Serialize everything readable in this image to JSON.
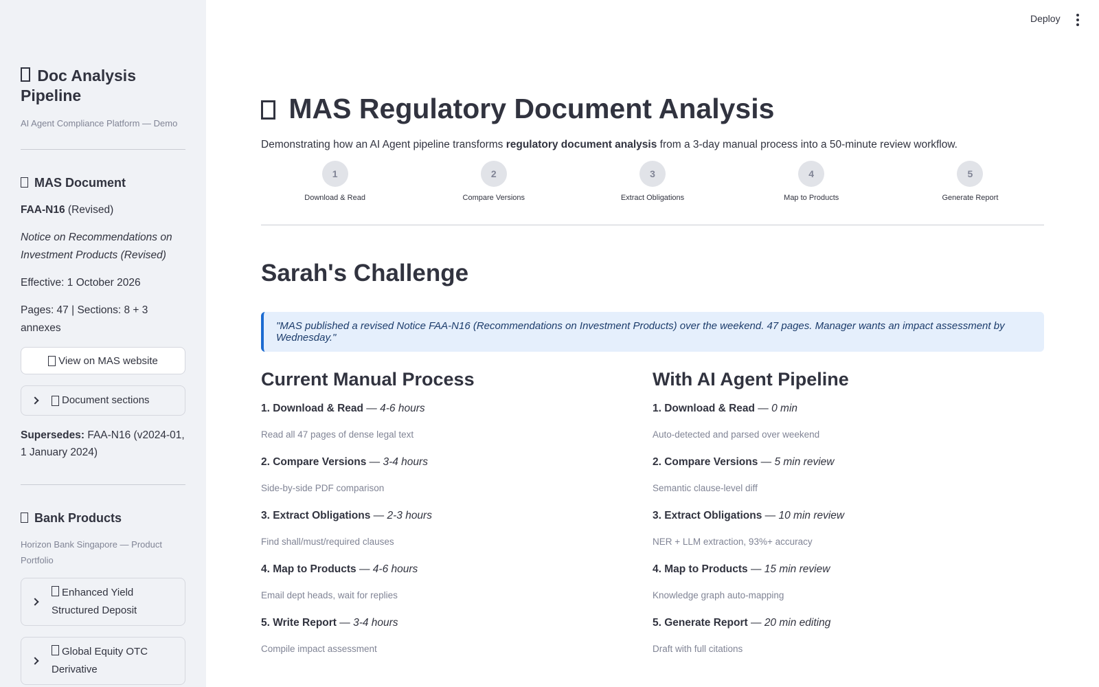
{
  "sidebar": {
    "title": "Doc Analysis Pipeline",
    "caption": "AI Agent Compliance Platform — Demo",
    "mas_heading": "MAS Document",
    "doc_code": "FAA-N16",
    "doc_status": "(Revised)",
    "doc_title": "Notice on Recommendations on Investment Products (Revised)",
    "effective": "Effective: 1 October 2026",
    "pages": "Pages: 47 | Sections: 8 + 3 annexes",
    "view_button": "View on MAS website",
    "sections_expander": "Document sections",
    "supersedes_label": "Supersedes:",
    "supersedes_value": "FAA-N16 (v2024-01, 1 January 2024)",
    "bank_heading": "Bank Products",
    "bank_caption": "Horizon Bank Singapore — Product Portfolio",
    "products": [
      {
        "label": "Enhanced Yield Structured Deposit"
      },
      {
        "label": "Global Equity OTC Derivative"
      }
    ]
  },
  "header": {
    "deploy": "Deploy"
  },
  "main": {
    "title": "MAS Regulatory Document Analysis",
    "intro_prefix": "Demonstrating how an AI Agent pipeline transforms ",
    "intro_bold": "regulatory document analysis",
    "intro_suffix": " from a 3-day manual process into a 50-minute review workflow.",
    "steps": [
      {
        "num": "1",
        "label": "Download & Read"
      },
      {
        "num": "2",
        "label": "Compare Versions"
      },
      {
        "num": "3",
        "label": "Extract Obligations"
      },
      {
        "num": "4",
        "label": "Map to Products"
      },
      {
        "num": "5",
        "label": "Generate Report"
      }
    ],
    "challenge_title": "Sarah's Challenge",
    "quote": "\"MAS published a revised Notice FAA-N16 (Recommendations on Investment Products) over the weekend. 47 pages. Manager wants an impact assessment by Wednesday.\"",
    "manual": {
      "title": "Current Manual Process",
      "items": [
        {
          "title": "1. Download & Read",
          "time": "4-6 hours",
          "desc": "Read all 47 pages of dense legal text"
        },
        {
          "title": "2. Compare Versions",
          "time": "3-4 hours",
          "desc": "Side-by-side PDF comparison"
        },
        {
          "title": "3. Extract Obligations",
          "time": "2-3 hours",
          "desc": "Find shall/must/required clauses"
        },
        {
          "title": "4. Map to Products",
          "time": "4-6 hours",
          "desc": "Email dept heads, wait for replies"
        },
        {
          "title": "5. Write Report",
          "time": "3-4 hours",
          "desc": "Compile impact assessment"
        }
      ]
    },
    "ai": {
      "title": "With AI Agent Pipeline",
      "items": [
        {
          "title": "1. Download & Read",
          "time": "0 min",
          "desc": "Auto-detected and parsed over weekend"
        },
        {
          "title": "2. Compare Versions",
          "time": "5 min review",
          "desc": "Semantic clause-level diff"
        },
        {
          "title": "3. Extract Obligations",
          "time": "10 min review",
          "desc": "NER + LLM extraction, 93%+ accuracy"
        },
        {
          "title": "4. Map to Products",
          "time": "15 min review",
          "desc": "Knowledge graph auto-mapping"
        },
        {
          "title": "5. Generate Report",
          "time": "20 min editing",
          "desc": "Draft with full citations"
        }
      ]
    }
  }
}
